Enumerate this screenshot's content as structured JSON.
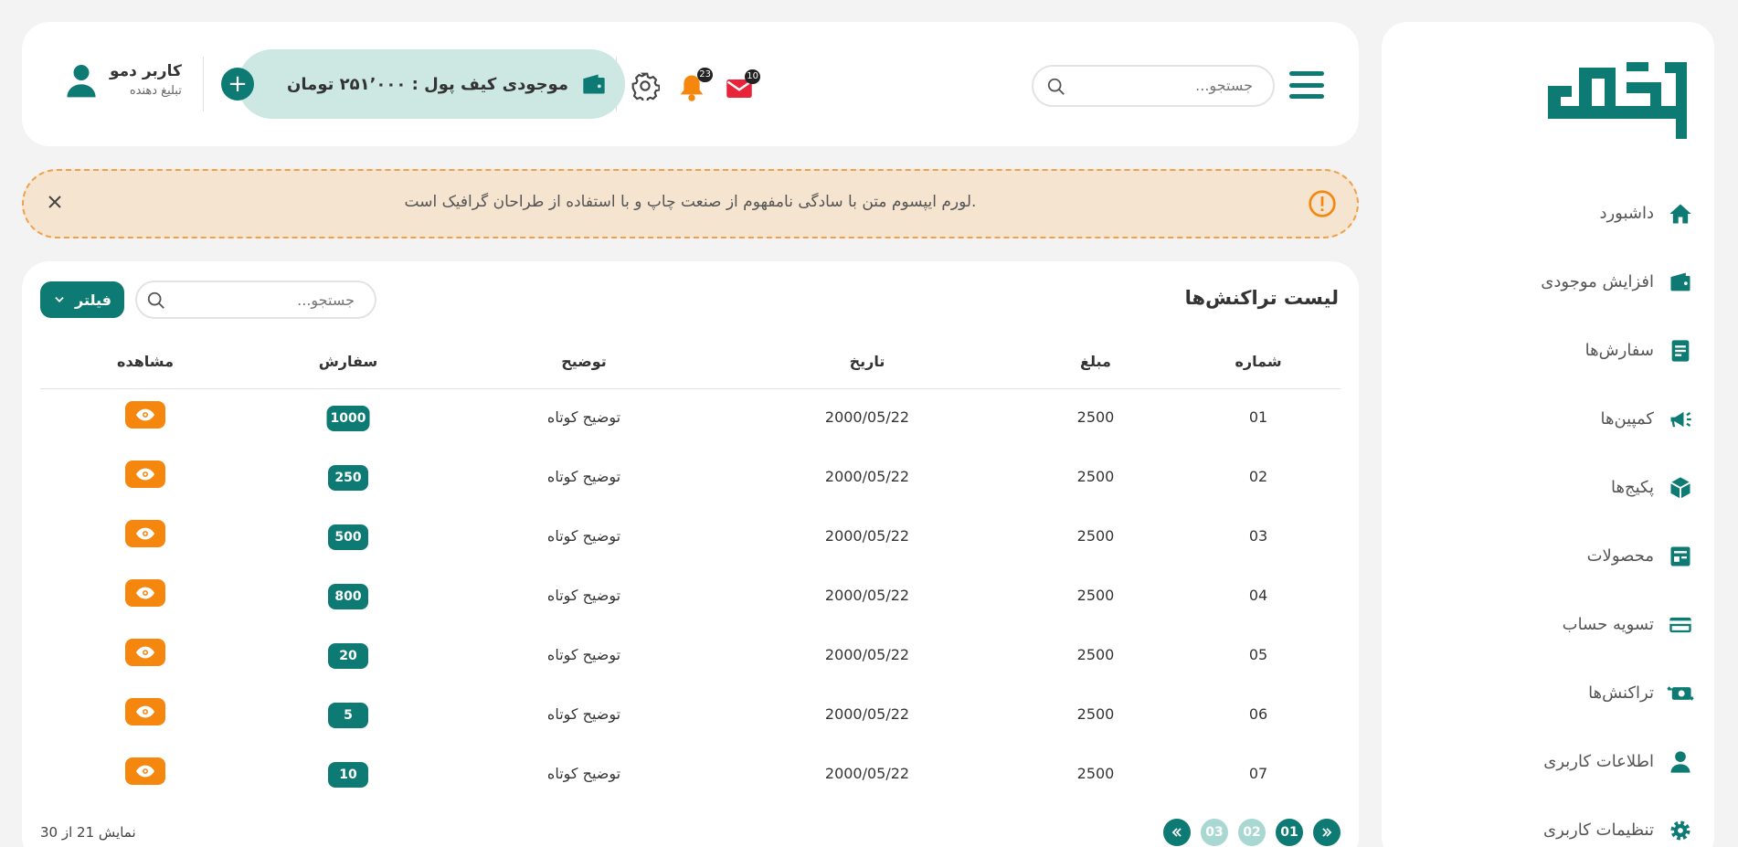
{
  "sidebar": {
    "logo_text": "زیگنو",
    "items": [
      {
        "label": "داشبورد",
        "icon": "home-icon"
      },
      {
        "label": "افزایش موجودی",
        "icon": "wallet-icon"
      },
      {
        "label": "سفارش‌ها",
        "icon": "document-icon"
      },
      {
        "label": "کمپین‌ها",
        "icon": "megaphone-icon"
      },
      {
        "label": "پکیج‌ها",
        "icon": "package-icon"
      },
      {
        "label": "محصولات",
        "icon": "products-icon"
      },
      {
        "label": "تسویه حساب",
        "icon": "card-icon"
      },
      {
        "label": "تراکنش‌ها",
        "icon": "exchange-icon"
      },
      {
        "label": "اطلاعات کاربری",
        "icon": "user-icon"
      },
      {
        "label": "تنظیمات کاربری",
        "icon": "gear-icon"
      }
    ]
  },
  "header": {
    "search_placeholder": "جستجو...",
    "mail_count": "10",
    "bell_count": "23",
    "wallet_text": "موجودی کیف پول : ۲۵۱٬۰۰۰ تومان",
    "plus": "+",
    "user_name": "کاربر دمو",
    "user_role": "تبلیغ دهنده"
  },
  "notice": {
    "text": ".لورم ایپسوم متن با سادگی نامفهوم از صنعت چاپ و با استفاده از طراحان گرافیک است"
  },
  "table": {
    "title": "لیست تراکنش‌ها",
    "search_placeholder": "جستجو...",
    "filter_label": "فیلتر",
    "columns": {
      "number": "شماره",
      "amount": "مبلغ",
      "date": "تاریخ",
      "desc": "توضیح",
      "order": "سفارش",
      "view": "مشاهده"
    },
    "rows": [
      {
        "number": "01",
        "amount": "2500",
        "date": "2000/05/22",
        "desc": "توضیح کوتاه",
        "order": "1000"
      },
      {
        "number": "02",
        "amount": "2500",
        "date": "2000/05/22",
        "desc": "توضیح کوتاه",
        "order": "250"
      },
      {
        "number": "03",
        "amount": "2500",
        "date": "2000/05/22",
        "desc": "توضیح کوتاه",
        "order": "500"
      },
      {
        "number": "04",
        "amount": "2500",
        "date": "2000/05/22",
        "desc": "توضیح کوتاه",
        "order": "800"
      },
      {
        "number": "05",
        "amount": "2500",
        "date": "2000/05/22",
        "desc": "توضیح کوتاه",
        "order": "20"
      },
      {
        "number": "06",
        "amount": "2500",
        "date": "2000/05/22",
        "desc": "توضیح کوتاه",
        "order": "5"
      },
      {
        "number": "07",
        "amount": "2500",
        "date": "2000/05/22",
        "desc": "توضیح کوتاه",
        "order": "10"
      }
    ],
    "showing": "نمایش 21 از 30",
    "pages": [
      "01",
      "02",
      "03"
    ],
    "current_page": "01"
  },
  "colors": {
    "primary": "#0d7a73",
    "orange": "#f5870f",
    "notice_bg": "#f5e4cf"
  }
}
